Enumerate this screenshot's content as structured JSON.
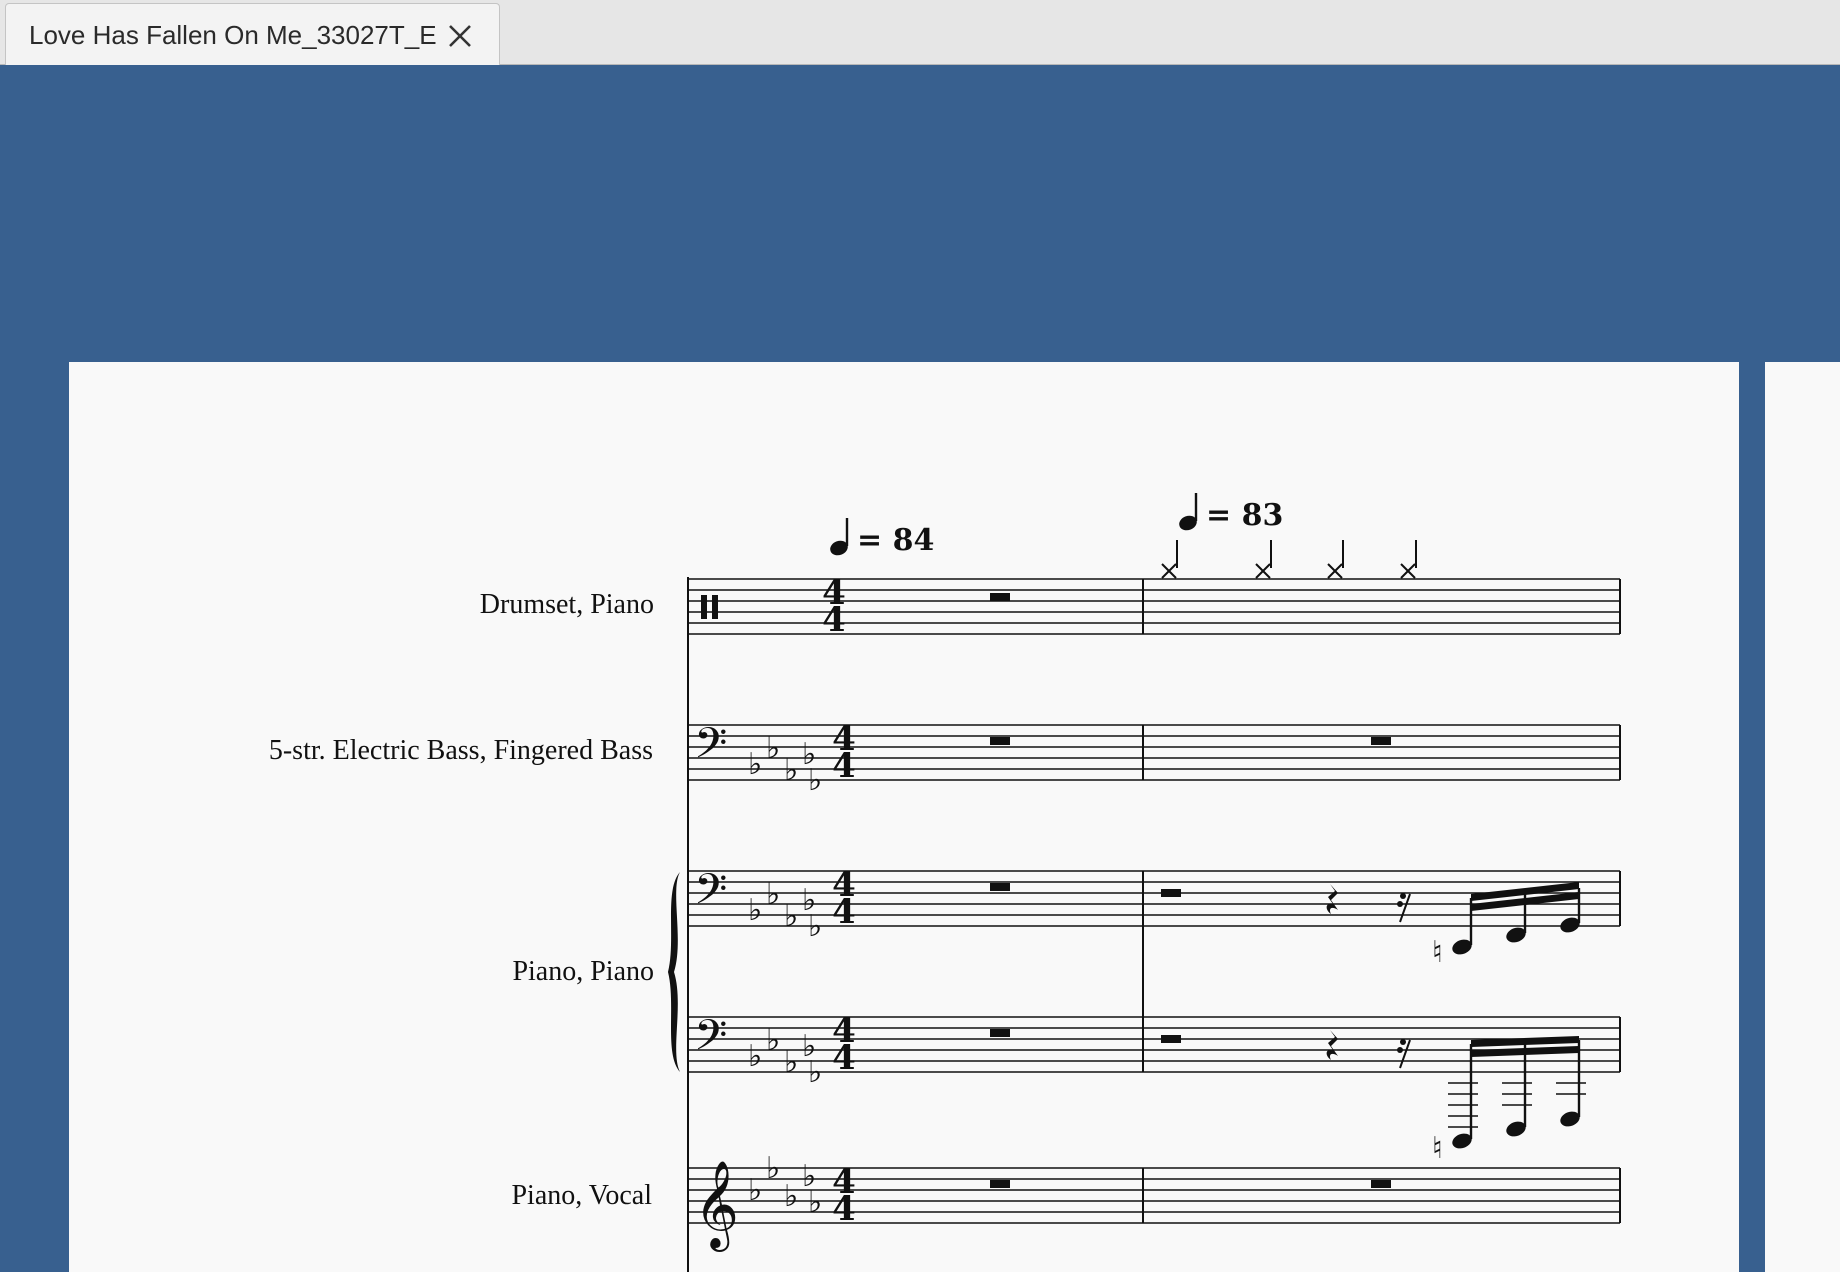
{
  "tab": {
    "title": "Love Has Fallen On Me_33027T_E",
    "close_icon": "close-icon"
  },
  "colors": {
    "background": "#38608f",
    "page": "#f9f9f9",
    "tabbar": "#e6e6e6"
  },
  "score": {
    "tempos": [
      {
        "label": "= 84"
      },
      {
        "label": "= 83"
      }
    ],
    "time_signature": {
      "numerator": "4",
      "denominator": "4"
    },
    "instruments": [
      {
        "label": "Drumset, Piano"
      },
      {
        "label": "5-str. Electric Bass, Fingered Bass"
      },
      {
        "label": "Piano, Piano"
      },
      {
        "label": "Piano, Vocal"
      }
    ]
  }
}
